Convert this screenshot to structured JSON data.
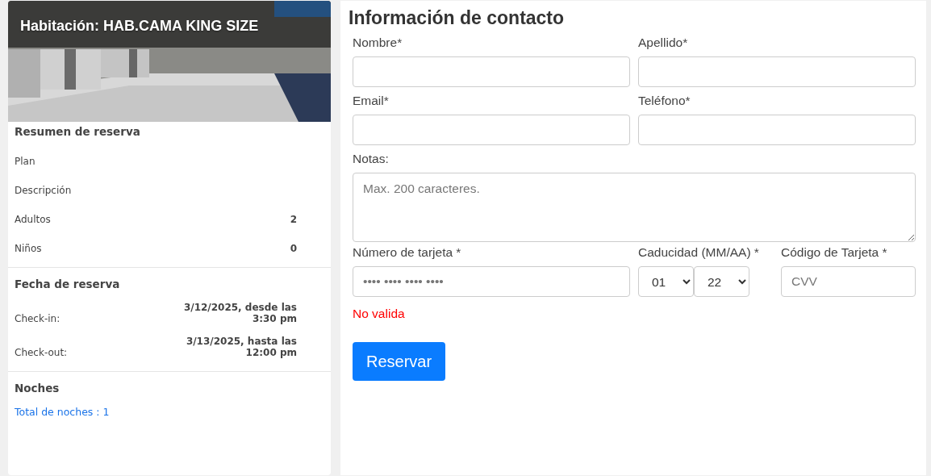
{
  "summary": {
    "room_title": "Habitación: HAB.CAMA KING SIZE",
    "sections": [
      {
        "title": "Resumen de reserva",
        "rows": [
          {
            "label": "Plan"
          },
          {
            "label": "Descripción"
          },
          {
            "label": "Adultos",
            "value": "2"
          },
          {
            "label": "Niños",
            "value": "0"
          }
        ]
      },
      {
        "title": "Fecha de reserva",
        "rows": [
          {
            "label": "Check-in:",
            "value": "3/12/2025, desde las 3:30 pm"
          },
          {
            "label": "Check-out:",
            "value": "3/13/2025, hasta las 12:00 pm"
          }
        ]
      },
      {
        "title": "Noches",
        "link": "Total de noches : 1"
      }
    ]
  },
  "contact": {
    "title": "Información de contacto",
    "fields": [
      {
        "label": "Nombre*",
        "kind": "input"
      },
      {
        "label": "Apellido*",
        "kind": "input"
      },
      {
        "label": "Email*",
        "kind": "input"
      },
      {
        "label": "Teléfono*",
        "kind": "input"
      },
      {
        "label": "Notas:",
        "kind": "textarea",
        "placeholder": "Max. 200 caracteres."
      }
    ],
    "card": {
      "number": {
        "label": "Número de tarjeta *",
        "placeholder": "•••• •••• •••• ••••",
        "error": "No valida"
      },
      "expiry": {
        "label": "Caducidad (MM/AA) *",
        "month": "01",
        "year": "22"
      },
      "cvv": {
        "label": "Código de Tarjeta *",
        "placeholder": "CVV"
      }
    },
    "submit": "Reservar"
  }
}
